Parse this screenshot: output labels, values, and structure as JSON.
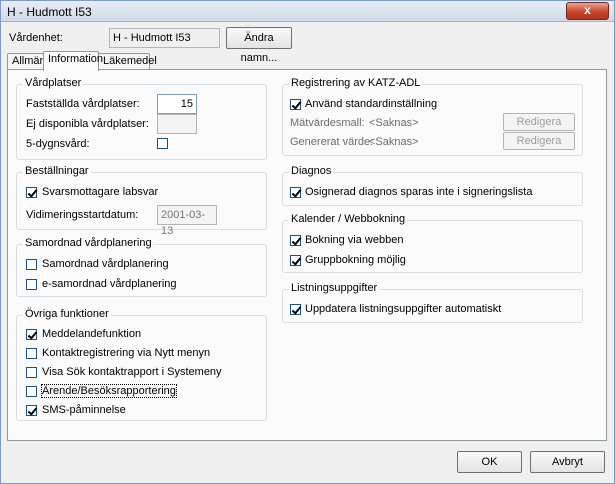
{
  "window": {
    "title": "H - Hudmott I53",
    "close_glyph": "x"
  },
  "header": {
    "unit_label": "Vårdenhet:",
    "unit_value": "H - Hudmott I53",
    "change_name_button": "Ändra namn..."
  },
  "tabs": [
    {
      "label": "Allmänt"
    },
    {
      "label": "Information"
    },
    {
      "label": "Läkemedel"
    }
  ],
  "vardplatser": {
    "title": "Vårdplatser",
    "fixed_label": "Fastställda vårdplatser:",
    "fixed_value": "15",
    "unavailable_label": "Ej disponibla vårdplatser:",
    "unavailable_value": "",
    "five_day_label": "5-dygnsvård:",
    "five_day_checked": false
  },
  "bestallningar": {
    "title": "Beställningar",
    "reply_label": "Svarsmottagare labsvar",
    "reply_checked": true,
    "date_label": "Vidimeringsstartdatum:",
    "date_value": "2001-03-13"
  },
  "samordnad": {
    "title": "Samordnad vårdplanering",
    "items": [
      {
        "label": "Samordnad vårdplanering",
        "checked": false
      },
      {
        "label": "e-samordnad vårdplanering",
        "checked": false
      }
    ]
  },
  "ovriga": {
    "title": "Övriga funktioner",
    "items": [
      {
        "label": "Meddelandefunktion",
        "checked": true
      },
      {
        "label": "Kontaktregistrering via Nytt menyn",
        "checked": false
      },
      {
        "label": "Visa Sök kontaktrapport i Systemeny",
        "checked": false
      },
      {
        "label": "Ärende/Besöksrapportering",
        "checked": false
      },
      {
        "label": "SMS-påminnelse",
        "checked": true
      }
    ]
  },
  "katz": {
    "title": "Registrering av KATZ-ADL",
    "standard_label": "Använd standardinställning",
    "standard_checked": true,
    "template_label": "Mätvärdesmall:",
    "template_value": "<Saknas>",
    "generated_label": "Genererat värde:",
    "generated_value": "<Saknas>",
    "edit_button_1": "Redigera",
    "edit_button_2": "Redigera"
  },
  "diagnos": {
    "title": "Diagnos",
    "label": "Osignerad diagnos sparas inte i signeringslista",
    "checked": true
  },
  "kalender": {
    "title": "Kalender / Webbokning",
    "items": [
      {
        "label": "Bokning via webben",
        "checked": true
      },
      {
        "label": "Gruppbokning möjlig",
        "checked": true
      }
    ]
  },
  "listning": {
    "title": "Listningsuppgifter",
    "label": "Uppdatera listningsuppgifter automatiskt",
    "checked": true
  },
  "footer": {
    "ok_button": "OK",
    "cancel_button": "Avbryt"
  }
}
